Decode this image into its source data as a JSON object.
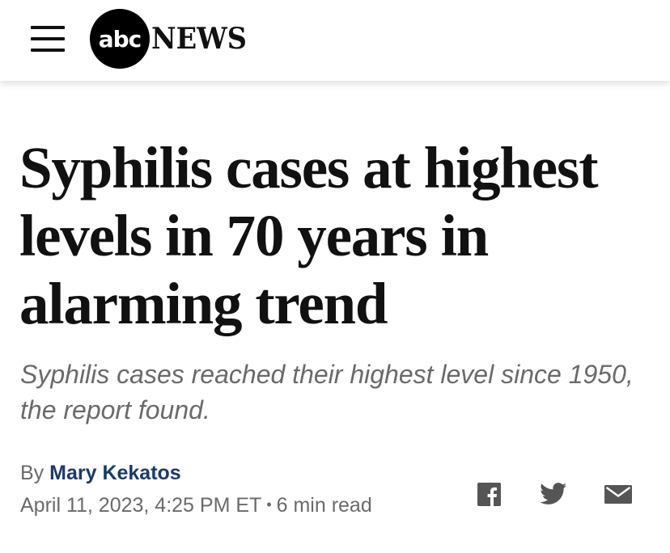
{
  "header": {
    "logo": {
      "circle_text": "abc",
      "word": "NEWS"
    },
    "icons": {
      "menu": "hamburger-menu-icon"
    }
  },
  "article": {
    "headline": "Syphilis cases at highest levels in 70 years in alarming trend",
    "subheadline": "Syphilis cases reached their highest level since 1950, the report found.",
    "byline_prefix": "By",
    "author": "Mary Kekatos",
    "date": "April 11, 2023, 4:25 PM ET",
    "separator": "•",
    "read_time": "6 min read"
  },
  "share": {
    "icons": [
      "facebook-icon",
      "twitter-icon",
      "email-icon"
    ]
  },
  "colors": {
    "text": "#111111",
    "muted": "#6a6a6a",
    "author_link": "#1a3a6b",
    "icon": "#555555"
  }
}
